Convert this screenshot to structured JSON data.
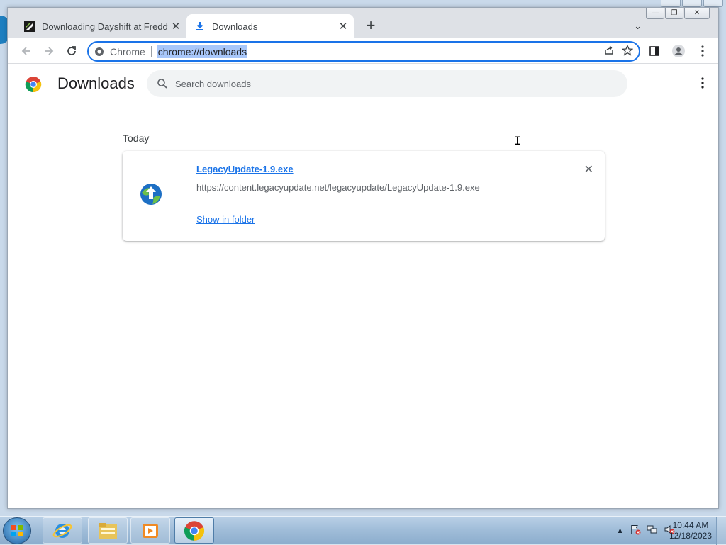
{
  "browser": {
    "tabs": [
      {
        "title": "Downloading Dayshift at Freddy",
        "active": false
      },
      {
        "title": "Downloads",
        "active": true
      }
    ],
    "omnibox": {
      "chip_label": "Chrome",
      "url": "chrome://downloads"
    }
  },
  "page": {
    "title": "Downloads",
    "search_placeholder": "Search downloads",
    "section_label": "Today",
    "downloads": [
      {
        "file_name": "LegacyUpdate-1.9.exe",
        "url": "https://content.legacyupdate.net/legacyupdate/LegacyUpdate-1.9.exe",
        "action_label": "Show in folder"
      }
    ]
  },
  "taskbar": {
    "time": "10:44 AM",
    "date": "12/18/2023"
  },
  "colors": {
    "accent": "#1a73e8",
    "titlebar": "#dee1e6",
    "url_highlight": "#a8c7fa"
  }
}
